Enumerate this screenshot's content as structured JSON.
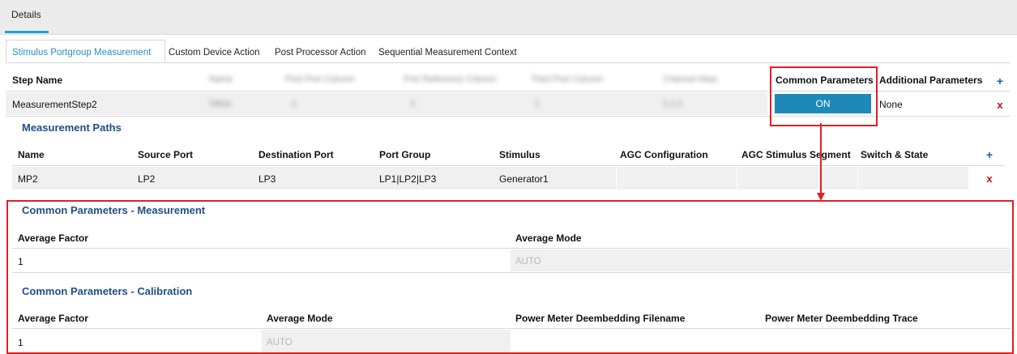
{
  "top_tab": "Details",
  "subtabs": [
    "Stimulus Portgroup Measurement",
    "Custom Device Action",
    "Post Processor Action",
    "Sequential Measurement Context"
  ],
  "step": {
    "header": {
      "step_name": "Step Name",
      "common": "Common Parameters",
      "additional": "Additional Parameters",
      "blurred": [
        "Name",
        "First Port Column",
        "Port Reference Column",
        "Third Port Column",
        "Channel Alias"
      ]
    },
    "row": {
      "name": "MeasurementStep2",
      "common_value": "ON",
      "additional_value": "None",
      "blurred": [
        "Value",
        "1",
        "1",
        "1",
        "1,1,1"
      ]
    }
  },
  "paths": {
    "title": "Measurement Paths",
    "headers": [
      "Name",
      "Source Port",
      "Destination Port",
      "Port Group",
      "Stimulus",
      "AGC Configuration",
      "AGC Stimulus Segment",
      "Switch & State"
    ],
    "row": [
      "MP2",
      "LP2",
      "LP3",
      "LP1|LP2|LP3",
      "Generator1",
      "",
      "",
      ""
    ]
  },
  "measurement": {
    "title": "Common Parameters - Measurement",
    "headers": [
      "Average Factor",
      "Average Mode"
    ],
    "values": [
      "1",
      "AUTO"
    ]
  },
  "calibration": {
    "title": "Common Parameters - Calibration",
    "headers": [
      "Average Factor",
      "Average Mode",
      "Power Meter Deembedding Filename",
      "Power Meter Deembedding Trace"
    ],
    "values": [
      "1",
      "AUTO",
      "",
      ""
    ]
  },
  "buttons": {
    "plus": "+",
    "delete": "x"
  },
  "colors": {
    "accent": "#1e88b8",
    "highlight": "#e01f26",
    "section": "#1f4e8a"
  },
  "icons": {
    "add": "plus-icon",
    "delete": "delete-x-icon",
    "arrow": "arrow-down-icon"
  }
}
